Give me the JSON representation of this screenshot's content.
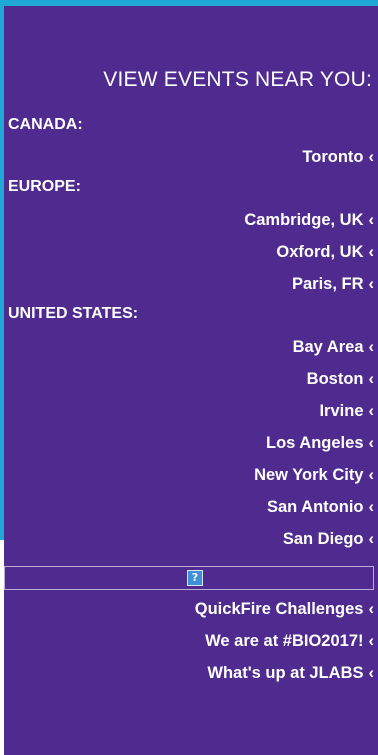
{
  "heading": "VIEW EVENTS NEAR YOU:",
  "regions": {
    "canada": {
      "label": "CANADA:",
      "cities": [
        "Toronto"
      ]
    },
    "europe": {
      "label": "EUROPE:",
      "cities": [
        "Cambridge, UK",
        "Oxford, UK",
        "Paris, FR"
      ]
    },
    "us": {
      "label": "UNITED STATES:",
      "cities": [
        "Bay Area",
        "Boston",
        "Irvine",
        "Los Angeles",
        "New York City",
        "San Antonio",
        "San Diego"
      ]
    }
  },
  "links": [
    "QuickFire Challenges",
    "We are at #BIO2017!",
    "What's up at JLABS"
  ],
  "arrow_glyph": "‹",
  "help_glyph": "?",
  "colors": {
    "panel": "#4f2a8f",
    "accent_bg": "#1fa7d6",
    "text": "#ffffff"
  }
}
